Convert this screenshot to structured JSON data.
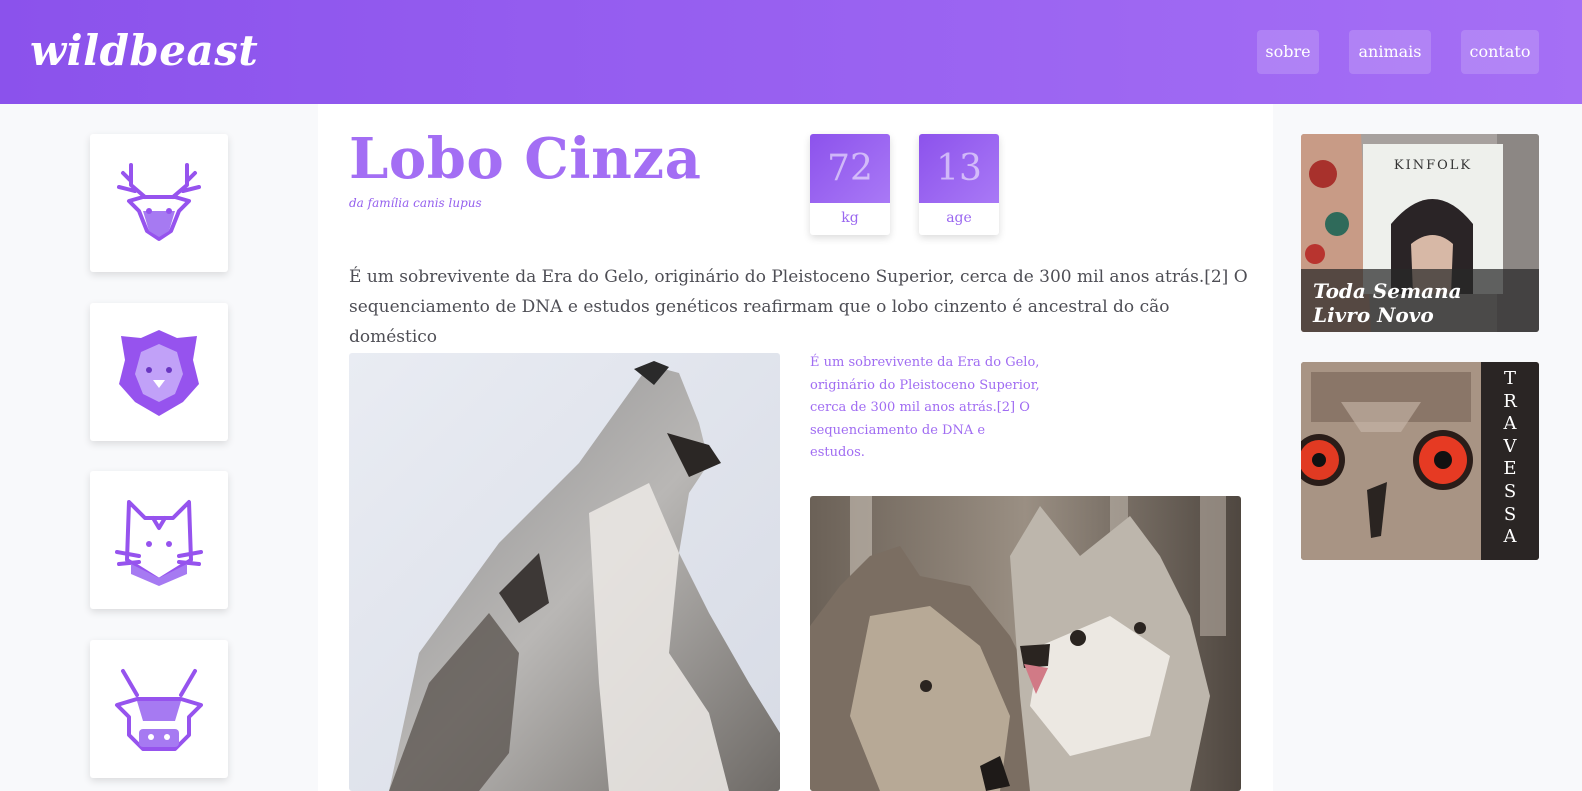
{
  "header": {
    "logo": "wildbeast",
    "nav": [
      "sobre",
      "animais",
      "contato"
    ]
  },
  "sidebar": {
    "animals": [
      "deer-icon",
      "lion-icon",
      "cat-icon",
      "cow-icon"
    ]
  },
  "main": {
    "title": "Lobo Cinza",
    "subtitle": "da família canis lupus",
    "stats": [
      {
        "value": "72",
        "unit": "kg"
      },
      {
        "value": "13",
        "unit": "age"
      }
    ],
    "lead": "É um sobrevivente da Era do Gelo, originário do Pleistoceno Superior, cerca de 300 mil anos atrás.[2] O sequenciamento de DNA e estudos genéticos reafirmam que o lobo cinzento é ancestral do cão doméstico",
    "caption": "É um sobrevivente da Era do Gelo, originário do Pleistoceno Superior, cerca de 300 mil anos atrás.[2] O sequenciamento de DNA e estudos.",
    "images": [
      "howling-wolf-photo",
      "two-wolves-photo"
    ]
  },
  "ads": [
    {
      "magazine": "KINFOLK",
      "text_line1": "Toda Semana",
      "text_line2": "Livro Novo"
    },
    {
      "vertical": [
        "T",
        "R",
        "A",
        "V",
        "E",
        "S",
        "S",
        "A"
      ]
    }
  ],
  "colors": {
    "accent": "#a36ef4",
    "header_start": "#8b52ec",
    "header_end": "#a56ff5"
  }
}
